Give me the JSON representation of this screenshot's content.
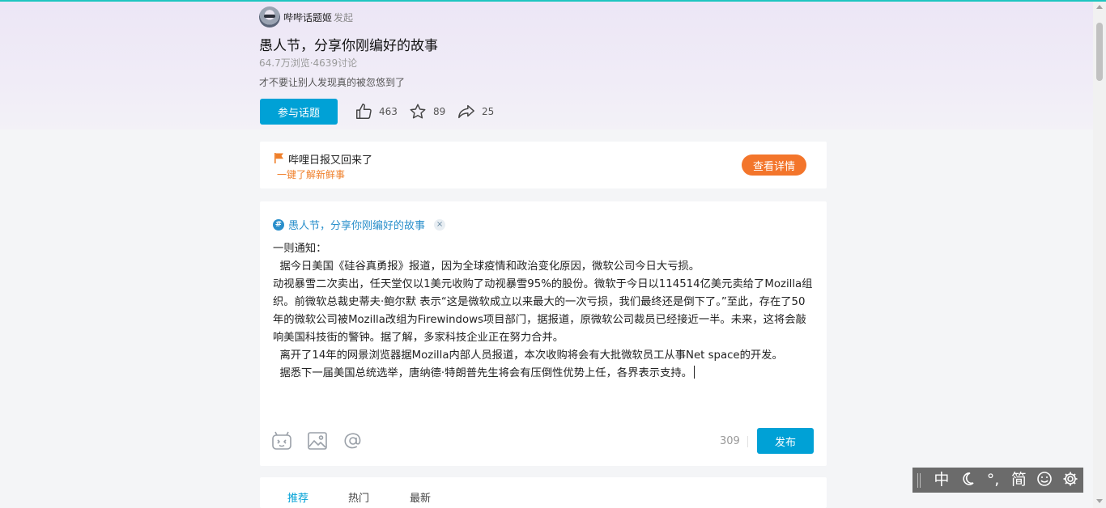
{
  "poster": {
    "name": "哔哔话题姬",
    "suffix": "发起"
  },
  "topic": {
    "title": "愚人节，分享你刚编好的故事",
    "stats": "64.7万浏览·4639讨论",
    "description": "才不要让别人发现真的被忽悠到了"
  },
  "actions": {
    "join_label": "参与话题",
    "like_count": "463",
    "favorite_count": "89",
    "share_count": "25"
  },
  "banner": {
    "title": "哔哩日报又回来了",
    "subtitle": "一键了解新鲜事",
    "button_label": "查看详情"
  },
  "editor": {
    "tag_label": "愚人节，分享你刚编好的故事",
    "tag_close": "×",
    "paragraphs": [
      "一则通知：",
      "  据今日美国《硅谷真勇报》报道，因为全球疫情和政治变化原因，微软公司今日大亏损。",
      "动视暴雪二次卖出，任天堂仅以1美元收购了动视暴雪95%的股份。微软于今日以114514亿美元卖给了Mozilla组织。前微软总裁史蒂夫·鲍尔默 表示“这是微软成立以来最大的一次亏损，我们最终还是倒下了。”至此，存在了50年的微软公司被Mozilla改组为Firewindows项目部门，据报道，原微软公司裁员已经接近一半。未来，这将会敲响美国科技街的警钟。据了解，多家科技企业正在努力合并。",
      "  离开了14年的网景浏览器据Mozilla内部人员报道，本次收购将会有大批微软员工从事Net space的开发。",
      "  据悉下一届美国总统选举，唐纳德·特朗普先生将会有压倒性优势上任，各界表示支持。"
    ],
    "char_count": "309",
    "publish_label": "发布"
  },
  "feed_tabs": [
    {
      "label": "推荐",
      "active": true
    },
    {
      "label": "热门",
      "active": false
    },
    {
      "label": "最新",
      "active": false
    }
  ],
  "ime_bar": {
    "lang": "中",
    "punct": "°,",
    "script": "简"
  },
  "colors": {
    "accent": "#00a1d6",
    "orange": "#f3752b",
    "tag": "#2a8fcb"
  }
}
